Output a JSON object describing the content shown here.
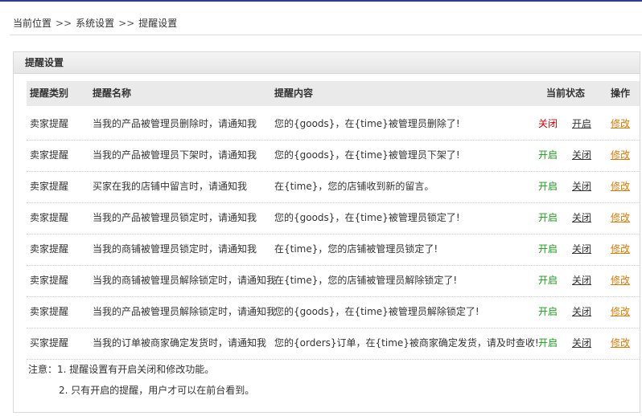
{
  "colors": {
    "status_on": "#1a9a1a",
    "status_off": "#d40000",
    "edit_link": "#e07800",
    "header_rule": "#2b3a9a"
  },
  "breadcrumb": {
    "current_label": "当前位置",
    "sep": ">>",
    "items": [
      "系统设置",
      "提醒设置"
    ]
  },
  "panel": {
    "title": "提醒设置",
    "columns": {
      "type": "提醒类别",
      "name": "提醒名称",
      "content": "提醒内容",
      "status": "当前状态",
      "action": "操作"
    },
    "rows": [
      {
        "type": "卖家提醒",
        "name": "当我的产品被管理员删除时，请通知我",
        "content": "您的{goods}，在{time}被管理员删除了!",
        "status": "关闭",
        "status_on": false,
        "toggle": "开启",
        "edit": "修改"
      },
      {
        "type": "卖家提醒",
        "name": "当我的产品被管理员下架时，请通知我",
        "content": "您的{goods}，在{time}被管理员下架了!",
        "status": "开启",
        "status_on": true,
        "toggle": "关闭",
        "edit": "修改"
      },
      {
        "type": "卖家提醒",
        "name": "买家在我的店铺中留言时，请通知我",
        "content": "在{time}，您的店铺收到新的留言。",
        "status": "开启",
        "status_on": true,
        "toggle": "关闭",
        "edit": "修改"
      },
      {
        "type": "卖家提醒",
        "name": "当我的产品被管理员锁定时，请通知我",
        "content": "您的{goods}，在{time}被管理员锁定了!",
        "status": "开启",
        "status_on": true,
        "toggle": "关闭",
        "edit": "修改"
      },
      {
        "type": "卖家提醒",
        "name": "当我的商铺被管理员锁定时，请通知我",
        "content": "在{time}，您的店铺被管理员锁定了!",
        "status": "开启",
        "status_on": true,
        "toggle": "关闭",
        "edit": "修改"
      },
      {
        "type": "卖家提醒",
        "name": "当我的商铺被管理员解除锁定时，请通知我",
        "content": "在{time}，您的店铺被管理员解除锁定了!",
        "status": "开启",
        "status_on": true,
        "toggle": "关闭",
        "edit": "修改"
      },
      {
        "type": "卖家提醒",
        "name": "当我的产品被管理员解除锁定时，请通知我",
        "content": "您的{goods}，在{time}被管理员解除锁定了!",
        "status": "开启",
        "status_on": true,
        "toggle": "关闭",
        "edit": "修改"
      },
      {
        "type": "买家提醒",
        "name": "当我的订单被商家确定发货时，请通知我",
        "content": "您的{orders}订单，在{time}被商家确定发货，请及时查收!",
        "status": "开启",
        "status_on": true,
        "toggle": "关闭",
        "edit": "修改"
      }
    ],
    "notes": {
      "line1": "注意：1. 提醒设置有开启关闭和修改功能。",
      "line2": "2. 只有开启的提醒，用户才可以在前台看到。"
    }
  }
}
